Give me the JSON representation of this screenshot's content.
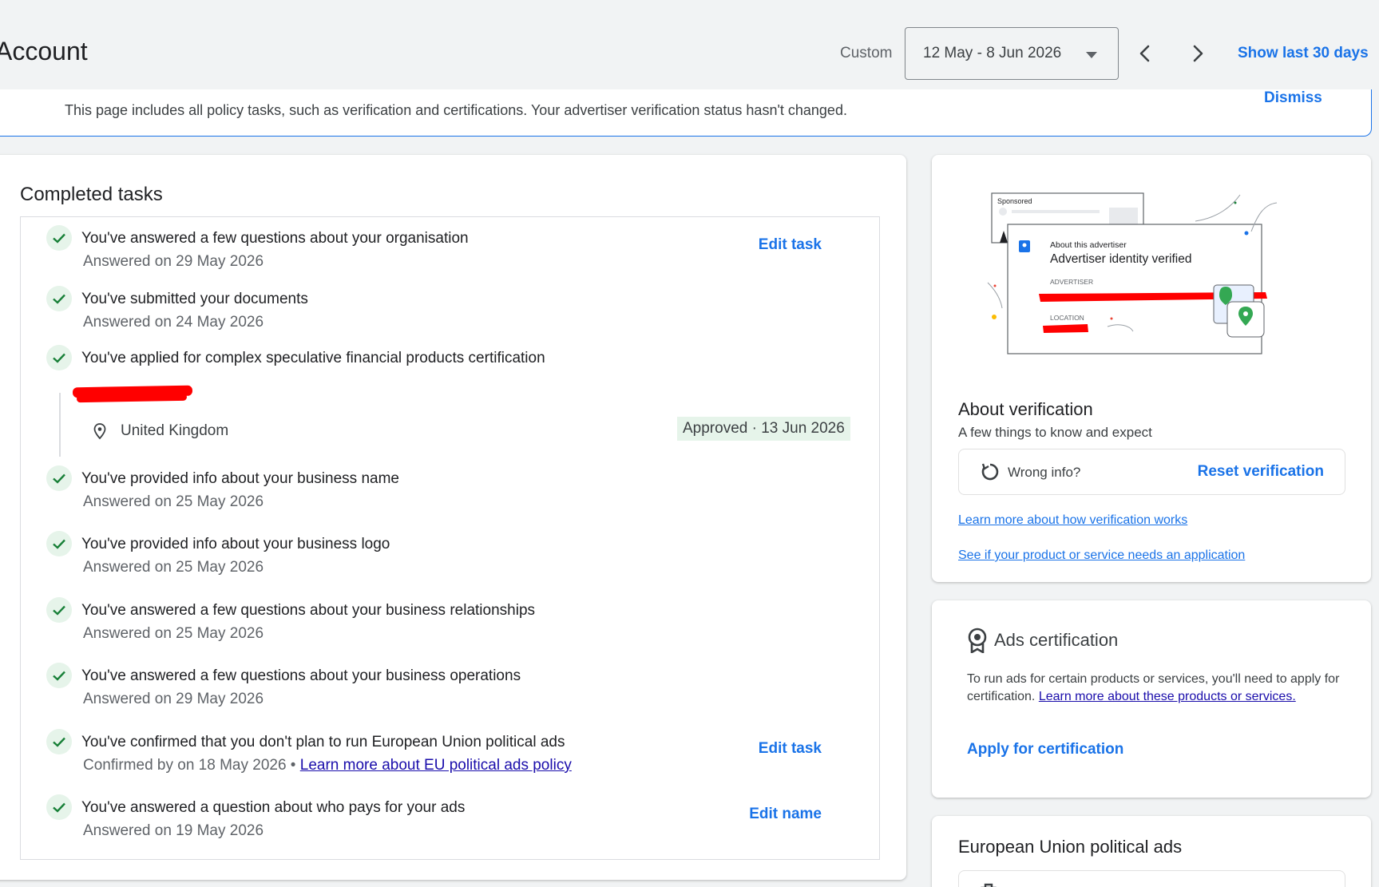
{
  "header": {
    "title": "Account",
    "custom_label": "Custom",
    "date_range": "12 May - 8 Jun 2026",
    "show_last_label": "Show last 30 days"
  },
  "banner": {
    "text": "This page includes all policy tasks, such as verification and certifications. Your advertiser verification status hasn't changed.",
    "dismiss": "Dismiss"
  },
  "tasks": {
    "title": "Completed tasks",
    "items": [
      {
        "title": "You've answered a few questions about your organisation",
        "sub": "Answered on 29 May 2026",
        "action": "Edit task"
      },
      {
        "title": "You've submitted your documents",
        "sub": "Answered on 24 May 2026"
      },
      {
        "title": "You've applied for complex speculative financial products certification",
        "location": "United Kingdom",
        "status": "Approved · 13 Jun 2026"
      },
      {
        "title": "You've provided info about your business name",
        "sub": "Answered on 25 May 2026"
      },
      {
        "title": "You've provided info about your business logo",
        "sub": "Answered on 25 May 2026"
      },
      {
        "title": "You've answered a few questions about your business relationships",
        "sub": "Answered on 25 May 2026"
      },
      {
        "title": "You've answered a few questions about your business operations",
        "sub": "Answered on 29 May 2026"
      },
      {
        "title": "You've confirmed that you don't plan to run European Union political ads",
        "sub": "Confirmed by on 18 May 2026 • ",
        "sub_link": "Learn more about EU political ads policy",
        "action": "Edit task"
      },
      {
        "title": "You've answered a question about who pays for your ads",
        "sub": "Answered on 19 May 2026",
        "action": "Edit name"
      }
    ]
  },
  "verification": {
    "illustration": {
      "sponsored": "Sponsored",
      "about": "About this advertiser",
      "verified": "Advertiser identity verified",
      "advertiser_label": "ADVERTISER",
      "location_label": "LOCATION"
    },
    "title": "About verification",
    "subtitle": "A few things to know and expect",
    "wrong_info": "Wrong info?",
    "reset": "Reset verification",
    "link1": "Learn more about how verification works",
    "link2": "See if your product or service needs an application"
  },
  "certification": {
    "title": "Ads certification",
    "body": "To run ads for certain products or services, you'll need to apply for certification. ",
    "body_link": "Learn more about these products or services.",
    "apply": "Apply for certification"
  },
  "eu": {
    "title": "European Union political ads"
  },
  "colors": {
    "accent": "#1a73e8",
    "success_bg": "#e6f4ea",
    "success": "#188038",
    "redaction": "#ff0000"
  },
  "icons": {
    "check": "check-icon",
    "location": "location-pin-icon",
    "reset": "refresh-icon",
    "certification": "award-ribbon-icon",
    "eu": "briefcase-icon"
  }
}
